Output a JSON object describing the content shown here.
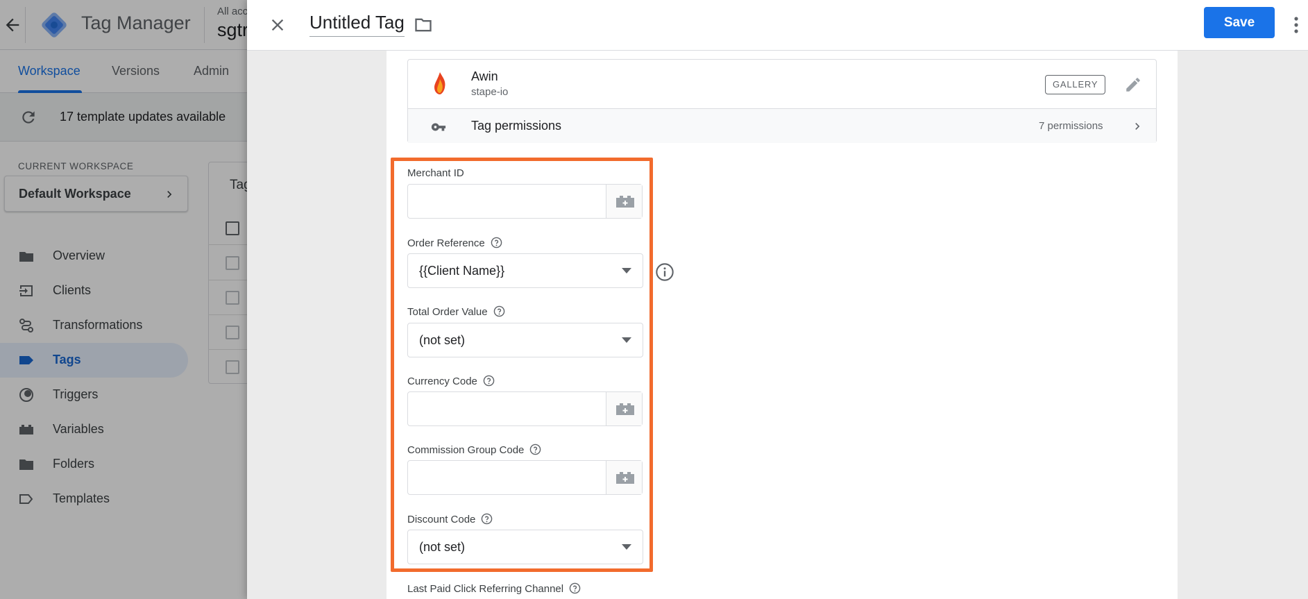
{
  "app": {
    "name": "Tag Manager",
    "account_line": "All acc",
    "container_name": "sgtr",
    "tabs": [
      "Workspace",
      "Versions",
      "Admin"
    ],
    "updates_banner": "17 template updates available",
    "current_workspace_label": "CURRENT WORKSPACE",
    "workspace_name": "Default Workspace",
    "tags_card_title": "Tag",
    "nav": [
      {
        "label": "Overview",
        "icon": "overview-icon"
      },
      {
        "label": "Clients",
        "icon": "clients-icon"
      },
      {
        "label": "Transformations",
        "icon": "transformations-icon"
      },
      {
        "label": "Tags",
        "icon": "tag-icon",
        "active": true
      },
      {
        "label": "Triggers",
        "icon": "trigger-icon"
      },
      {
        "label": "Variables",
        "icon": "variables-icon"
      },
      {
        "label": "Folders",
        "icon": "folder-icon"
      },
      {
        "label": "Templates",
        "icon": "templates-icon"
      }
    ]
  },
  "editor": {
    "title": "Untitled Tag",
    "save_label": "Save",
    "template": {
      "name": "Awin",
      "vendor": "stape-io",
      "badge": "GALLERY"
    },
    "permissions": {
      "label": "Tag permissions",
      "count": "7 permissions"
    },
    "fields": {
      "merchant_id": {
        "label": "Merchant ID",
        "value": ""
      },
      "order_reference": {
        "label": "Order Reference",
        "value": "{{Client Name}}"
      },
      "total_order_value": {
        "label": "Total Order Value",
        "value": "(not set)"
      },
      "currency_code": {
        "label": "Currency Code",
        "value": ""
      },
      "commission_group_code": {
        "label": "Commission Group Code",
        "value": ""
      },
      "discount_code": {
        "label": "Discount Code",
        "value": "(not set)"
      },
      "last_paid_click": {
        "label": "Last Paid Click Referring Channel"
      }
    }
  },
  "colors": {
    "accent": "#1a73e8",
    "highlight": "#f26b2d",
    "overlay_background": "#ebebeb"
  }
}
